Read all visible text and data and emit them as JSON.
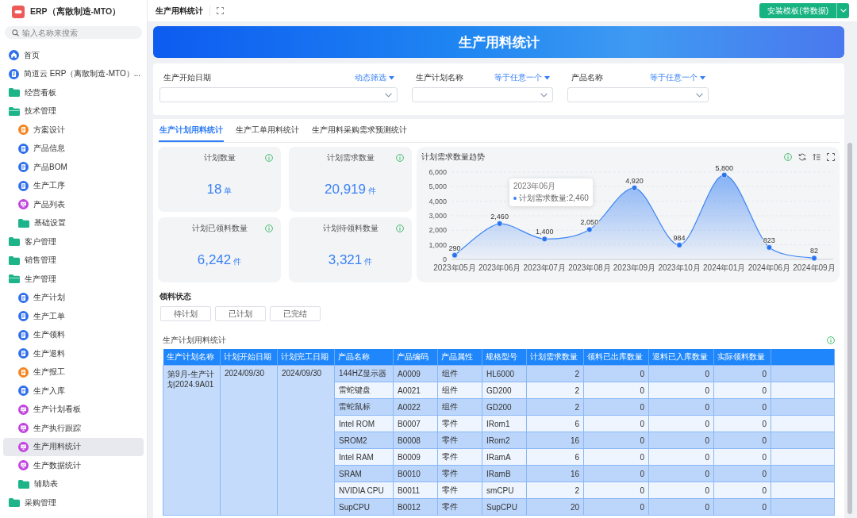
{
  "sidebar": {
    "app_title": "ERP（离散制造-MTO）",
    "search": {
      "placeholder": "输入名称来搜索"
    },
    "items": [
      {
        "label": "首页",
        "kind": "home",
        "color": "#2f6fed",
        "selected": false
      },
      {
        "label": "简道云 ERP（离散制造-MTO）...",
        "kind": "form",
        "color": "#2f6fed",
        "selected": false
      },
      {
        "label": "经营看板",
        "kind": "folder",
        "color": "#1db489",
        "expanded": false,
        "selected": false
      },
      {
        "label": "技术管理",
        "kind": "folder",
        "color": "#1db489",
        "expanded": true,
        "selected": false,
        "children": [
          {
            "label": "方案设计",
            "kind": "form",
            "color": "#f5841f",
            "selected": false
          },
          {
            "label": "产品信息",
            "kind": "form",
            "color": "#2f6fed",
            "selected": false
          },
          {
            "label": "产品BOM",
            "kind": "form",
            "color": "#2f6fed",
            "selected": false
          },
          {
            "label": "生产工序",
            "kind": "form",
            "color": "#2f6fed",
            "selected": false
          },
          {
            "label": "产品列表",
            "kind": "dashboard",
            "color": "#c143df",
            "selected": false
          },
          {
            "label": "基础设置",
            "kind": "folder",
            "color": "#1db489",
            "expanded": false,
            "selected": false
          }
        ]
      },
      {
        "label": "客户管理",
        "kind": "folder",
        "color": "#1db489",
        "expanded": false,
        "selected": false
      },
      {
        "label": "销售管理",
        "kind": "folder",
        "color": "#1db489",
        "expanded": false,
        "selected": false
      },
      {
        "label": "生产管理",
        "kind": "folder",
        "color": "#1db489",
        "expanded": true,
        "selected": false,
        "children": [
          {
            "label": "生产计划",
            "kind": "form",
            "color": "#2f6fed",
            "selected": false
          },
          {
            "label": "生产工单",
            "kind": "form",
            "color": "#2f6fed",
            "selected": false
          },
          {
            "label": "生产领料",
            "kind": "form",
            "color": "#2f6fed",
            "selected": false
          },
          {
            "label": "生产退料",
            "kind": "form",
            "color": "#2f6fed",
            "selected": false
          },
          {
            "label": "生产报工",
            "kind": "form",
            "color": "#f5841f",
            "selected": false
          },
          {
            "label": "生产入库",
            "kind": "form",
            "color": "#2f6fed",
            "selected": false
          },
          {
            "label": "生产计划看板",
            "kind": "dashboard",
            "color": "#c143df",
            "selected": false
          },
          {
            "label": "生产执行跟踪",
            "kind": "dashboard",
            "color": "#c143df",
            "selected": false
          },
          {
            "label": "生产用料统计",
            "kind": "dashboard",
            "color": "#c143df",
            "selected": true
          },
          {
            "label": "生产数据统计",
            "kind": "dashboard",
            "color": "#c143df",
            "selected": false
          },
          {
            "label": "辅助表",
            "kind": "folder",
            "color": "#1db489",
            "expanded": false,
            "selected": false
          }
        ]
      },
      {
        "label": "采购管理",
        "kind": "folder",
        "color": "#1db489",
        "expanded": false,
        "selected": false
      }
    ]
  },
  "top_bar": {
    "title": "生产用料统计",
    "button": {
      "label": "安装模板(带数据)"
    }
  },
  "banner": {
    "title": "生产用料统计"
  },
  "filters": [
    {
      "label": "生产开始日期",
      "mode": "动态筛选"
    },
    {
      "label": "生产计划名称",
      "mode": "等于任意一个"
    },
    {
      "label": "产品名称",
      "mode": "等于任意一个"
    }
  ],
  "tabs": [
    {
      "label": "生产计划用料统计",
      "selected": true
    },
    {
      "label": "生产工单用料统计",
      "selected": false
    },
    {
      "label": "生产用料采购需求预测统计",
      "selected": false
    }
  ],
  "stats": [
    {
      "title": "计划数量",
      "value": "18",
      "unit": "单"
    },
    {
      "title": "计划需求数量",
      "value": "20,919",
      "unit": "件"
    },
    {
      "title": "计划已领料数量",
      "value": "6,242",
      "unit": "件"
    },
    {
      "title": "计划待领料数量",
      "value": "3,321",
      "unit": "件"
    }
  ],
  "trend_chart": {
    "chart_data": [
      {
        "type": "area",
        "title": "计划需求数量趋势",
        "categories": [
          "2023年05月",
          "2023年06月",
          "2023年07月",
          "2023年08月",
          "2023年09月",
          "2023年10月",
          "2024年01月",
          "2024年06月",
          "2024年09月"
        ],
        "values": [
          290,
          2460,
          1400,
          2050,
          4920,
          984,
          5800,
          823,
          82
        ],
        "value_labels": [
          "290",
          "2,460",
          "1,400",
          "2,050",
          "4,920",
          "984",
          "5,800",
          "823",
          "82"
        ],
        "color": "#3d85f4",
        "ylim": [
          0,
          6000
        ],
        "yticks": [
          0,
          {
            "value": 1000,
            "label": "1,000"
          },
          {
            "value": 2000,
            "label": "2,000"
          },
          {
            "value": 3000,
            "label": "3,000"
          },
          {
            "value": 4000,
            "label": "4,000"
          },
          {
            "value": 5000,
            "label": "5,000"
          },
          {
            "value": 6000,
            "label": "6,000"
          }
        ],
        "marker": "circle",
        "grid": true
      }
    ],
    "tooltip": {
      "title": "2023年06月",
      "text": "计划需求数量:2,460"
    }
  },
  "status_filter": {
    "label": "领料状态",
    "options": [
      {
        "label": "待计划",
        "selected": false
      },
      {
        "label": "已计划",
        "selected": false
      },
      {
        "label": "已完结",
        "selected": false
      }
    ]
  },
  "table": {
    "title": "生产计划用料统计",
    "columns": [
      "生产计划名称",
      "计划开始日期",
      "计划完工日期",
      "产品名称",
      "产品编码",
      "产品属性",
      "规格型号",
      "计划需求数量",
      "领料已出库数量",
      "退料已入库数量",
      "实际领料数量"
    ],
    "groups": [
      {
        "plan_name": "第9月-生产计划2024.9A01",
        "start_date": "2024/09/30",
        "end_date": "2024/09/30",
        "rows": [
          [
            "144HZ显示器",
            "A0009",
            "组件",
            "HL6000",
            "2",
            "0",
            "0",
            "0"
          ],
          [
            "雷蛇键盘",
            "A0021",
            "组件",
            "GD200",
            "2",
            "0",
            "0",
            "0"
          ],
          [
            "雷蛇鼠标",
            "A0022",
            "组件",
            "GD200",
            "2",
            "0",
            "0",
            "0"
          ],
          [
            "Intel ROM",
            "B0007",
            "零件",
            "IRom1",
            "6",
            "0",
            "0",
            "0"
          ],
          [
            "SROM2",
            "B0008",
            "零件",
            "IRom2",
            "16",
            "0",
            "0",
            "0"
          ],
          [
            "Intel RAM",
            "B0009",
            "零件",
            "IRamA",
            "6",
            "0",
            "0",
            "0"
          ],
          [
            "SRAM",
            "B0010",
            "零件",
            "IRamB",
            "16",
            "0",
            "0",
            "0"
          ],
          [
            "NVIDIA CPU",
            "B0011",
            "零件",
            "smCPU",
            "2",
            "0",
            "0",
            "0"
          ],
          [
            "SupCPU",
            "B0012",
            "零件",
            "SupCPU",
            "20",
            "0",
            "0",
            "0"
          ]
        ]
      }
    ]
  }
}
